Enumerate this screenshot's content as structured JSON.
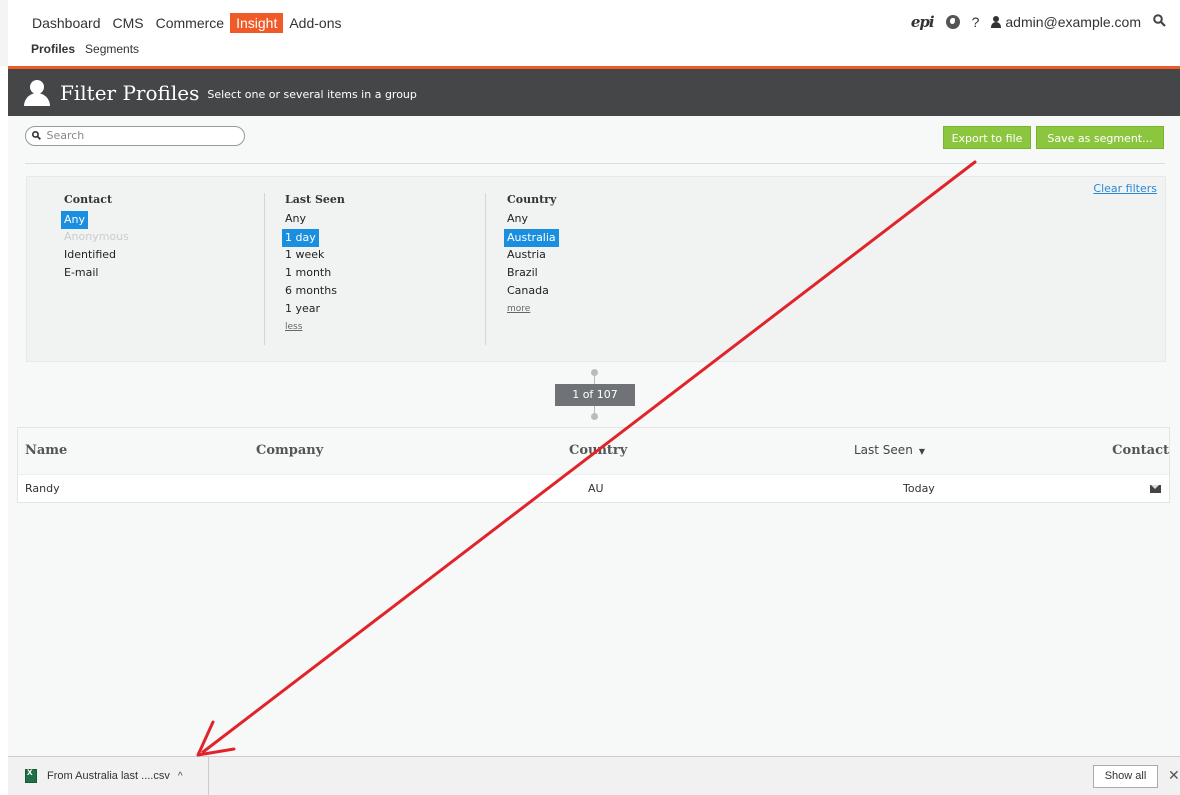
{
  "nav": {
    "items": [
      {
        "label": "Dashboard",
        "active": false
      },
      {
        "label": "CMS",
        "active": false
      },
      {
        "label": "Commerce",
        "active": false
      },
      {
        "label": "Insight",
        "active": true
      },
      {
        "label": "Add-ons",
        "active": false
      }
    ],
    "subnav": [
      {
        "label": "Profiles",
        "active": true
      },
      {
        "label": "Segments",
        "active": false
      }
    ],
    "logo_text": "epi",
    "help_label": "?",
    "user_email": "admin@example.com",
    "icons": {
      "logo": "episerver-logo-icon",
      "globe": "globe-icon",
      "user": "user-icon",
      "search": "search-icon"
    }
  },
  "header": {
    "title": "Filter Profiles",
    "subtitle": "Select one or several items in a group"
  },
  "toolbar": {
    "search_placeholder": "Search",
    "export_label": "Export to file",
    "save_segment_label": "Save as segment..."
  },
  "filters": {
    "clear_label": "Clear filters",
    "groups": [
      {
        "title": "Contact",
        "items": [
          {
            "label": "Any",
            "state": "selected"
          },
          {
            "label": "Anonymous",
            "state": "disabled"
          },
          {
            "label": "Identified",
            "state": "normal"
          },
          {
            "label": "E-mail",
            "state": "normal"
          }
        ]
      },
      {
        "title": "Last Seen",
        "items": [
          {
            "label": "Any",
            "state": "normal"
          },
          {
            "label": "1 day",
            "state": "selected"
          },
          {
            "label": "1 week",
            "state": "normal"
          },
          {
            "label": "1 month",
            "state": "normal"
          },
          {
            "label": "6 months",
            "state": "normal"
          },
          {
            "label": "1 year",
            "state": "normal"
          }
        ],
        "toggle": "less"
      },
      {
        "title": "Country",
        "items": [
          {
            "label": "Any",
            "state": "normal"
          },
          {
            "label": "Australia",
            "state": "selected"
          },
          {
            "label": "Austria",
            "state": "normal"
          },
          {
            "label": "Brazil",
            "state": "normal"
          },
          {
            "label": "Canada",
            "state": "normal"
          }
        ],
        "toggle": "more"
      }
    ]
  },
  "pager": {
    "label": "1 of 107"
  },
  "table": {
    "columns": [
      "Name",
      "Company",
      "Country",
      "Last Seen",
      "Contact"
    ],
    "rows": [
      {
        "name": "Randy",
        "company": "",
        "country": "AU",
        "last_seen": "Today",
        "contact_icon": "mail-icon"
      }
    ]
  },
  "downloads": {
    "file_name": "From Australia last ....csv",
    "show_all_label": "Show all",
    "close_label": "✕",
    "file_icon": "excel-file-icon"
  },
  "colors": {
    "brand_orange": "#f05a28",
    "header_dark": "#444648",
    "action_green": "#8cc63f",
    "selected_blue": "#1a8fe0",
    "annotation_red": "#e0242a"
  }
}
